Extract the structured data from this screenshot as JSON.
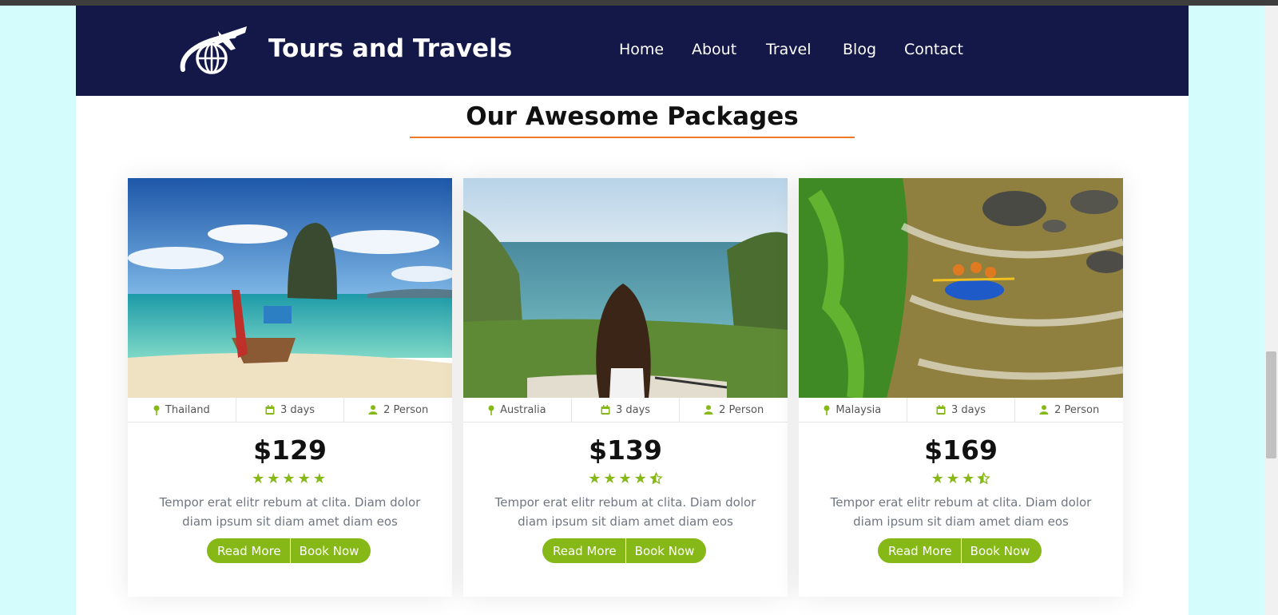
{
  "brand": {
    "name": "Tours and Travels",
    "logo_icon": "airplane-globe-icon"
  },
  "nav": {
    "items": [
      {
        "label": "Home"
      },
      {
        "label": "About"
      },
      {
        "label": "Travel"
      },
      {
        "label": "Blog"
      },
      {
        "label": "Contact"
      }
    ]
  },
  "section": {
    "title": "Our Awesome Packages"
  },
  "colors": {
    "navbar": "#131848",
    "accent": "#86b817",
    "underline": "#f07a2a",
    "page_bg": "#d5fcfc"
  },
  "packages": [
    {
      "image": "thailand-longtail-boat-beach-photo",
      "location": "Thailand",
      "duration": "3 days",
      "persons": "2 Person",
      "price": "$129",
      "rating": 5,
      "description": "Tempor erat elitr rebum at clita. Diam dolor diam ipsum sit diam amet diam eos",
      "read_more": "Read More",
      "book_now": "Book Now"
    },
    {
      "image": "australia-woman-overlooking-bay-photo",
      "location": "Australia",
      "duration": "3 days",
      "persons": "2 Person",
      "price": "$139",
      "rating": 4.5,
      "description": "Tempor erat elitr rebum at clita. Diam dolor diam ipsum sit diam amet diam eos",
      "read_more": "Read More",
      "book_now": "Book Now"
    },
    {
      "image": "malaysia-river-rafting-photo",
      "location": "Malaysia",
      "duration": "3 days",
      "persons": "2 Person",
      "price": "$169",
      "rating": 3.5,
      "description": "Tempor erat elitr rebum at clita. Diam dolor diam ipsum sit diam amet diam eos",
      "read_more": "Read More",
      "book_now": "Book Now"
    }
  ],
  "icons": {
    "location": "map-marker-icon",
    "duration": "calendar-icon",
    "persons": "user-icon",
    "rating": "star-icon"
  }
}
